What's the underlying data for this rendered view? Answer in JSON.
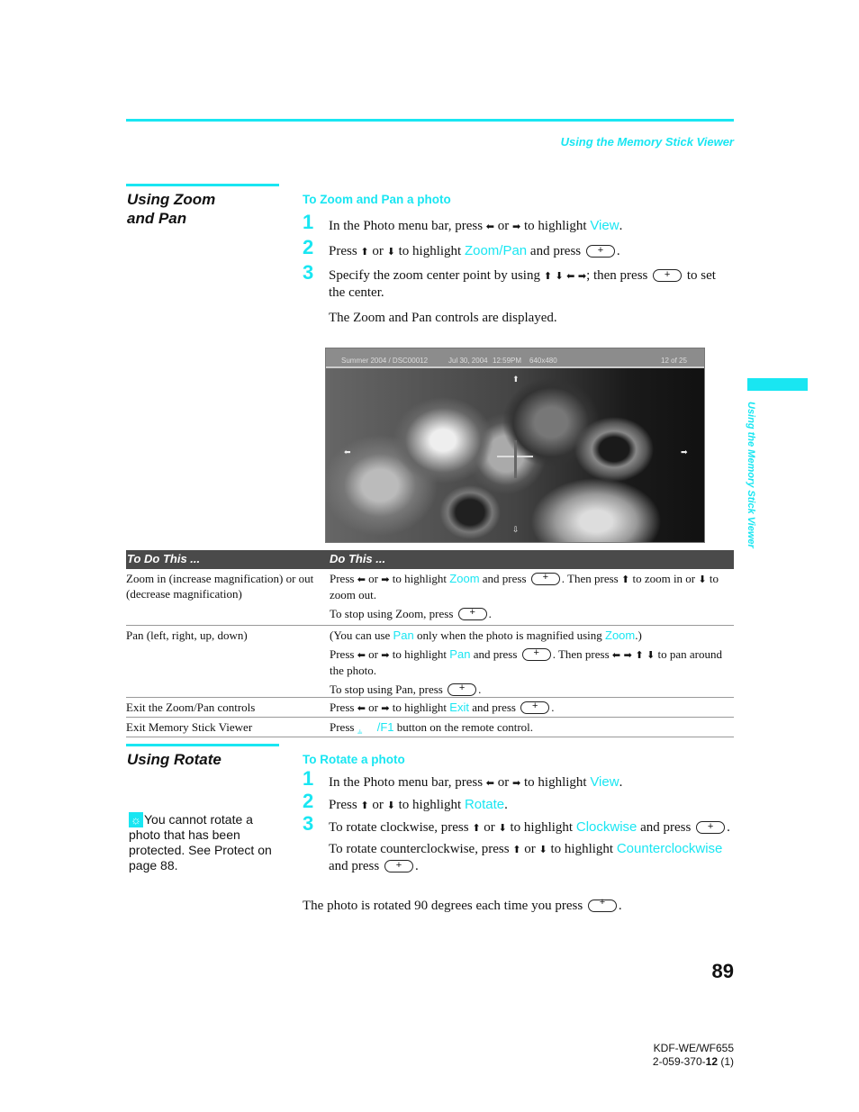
{
  "header": {
    "running_head": "Using the Memory Stick Viewer",
    "side_tab_label": "Using the Memory Stick Viewer"
  },
  "zoom_section": {
    "title_line1": "Using Zoom",
    "title_line2": "and Pan",
    "subhead": "To Zoom and Pan a photo",
    "steps": [
      {
        "num": "1",
        "pre": "In the Photo menu bar, press",
        "arrows1": "⬅",
        "or": "or",
        "arrows2": "➡",
        "mid": "to highlight",
        "hl": "View",
        "post": "."
      },
      {
        "num": "2",
        "pre": "Press",
        "arrows1": "⬆",
        "or": "or",
        "arrows2": "⬇",
        "mid": "to highlight",
        "hl": "Zoom/Pan",
        "post2": "and press",
        "end": "."
      },
      {
        "num": "3",
        "pre": "Specify the zoom center point by using",
        "arrows": "⬆ ⬇ ⬅ ➡",
        "mid": "; then press",
        "post": "to set the center."
      }
    ],
    "note": "The Zoom and Pan controls are displayed."
  },
  "screen": {
    "album": "Summer 2004  /  DSC00012",
    "date": "Jul 30, 2004",
    "time": "12:59PM",
    "resolution": "640x480",
    "counter": "12 of 25",
    "arrow_up": "⬆",
    "arrow_down": "⇩",
    "arrow_left": "⬅",
    "arrow_right": "➡"
  },
  "table": {
    "headers": [
      "To Do This ...",
      "Do This ..."
    ],
    "rows": [
      {
        "action": "Zoom in (increase magnification) or out (decrease magnification)",
        "p1_pre": "Press",
        "p1_a1": "⬅",
        "p1_or": "or",
        "p1_a2": "➡",
        "p1_mid": "to highlight",
        "p1_hl": "Zoom",
        "p1_post": "and press",
        "p1_then": ". Then press",
        "p1_up": "⬆",
        "p1_zin": "to zoom in or",
        "p1_down": "⬇",
        "p1_zout": "to zoom out.",
        "p2": "To stop using Zoom, press",
        "p2_end": "."
      },
      {
        "action": "Pan (left, right, up, down)",
        "p0_pre": "(You can use",
        "p0_hl1": "Pan",
        "p0_mid": "only when the photo is magnified using",
        "p0_hl2": "Zoom",
        "p0_end": ".)",
        "p1_pre": "Press",
        "p1_a1": "⬅",
        "p1_or": "or",
        "p1_a2": "➡",
        "p1_mid": "to highlight",
        "p1_hl": "Pan",
        "p1_post": "and press",
        "p1_then": ". Then press",
        "p1_arrows": "⬅ ➡ ⬆ ⬇",
        "p1_end": "to pan around the photo.",
        "p2": "To stop using Pan, press",
        "p2_end": "."
      },
      {
        "action": "Exit the Zoom/Pan controls",
        "p1_pre": "Press",
        "p1_a1": "⬅",
        "p1_or": "or",
        "p1_a2": "➡",
        "p1_mid": "to highlight",
        "p1_hl": "Exit",
        "p1_post": "and press",
        "p1_end": "."
      },
      {
        "action": "Exit Memory Stick Viewer",
        "p1_pre": "Press",
        "p1_icon": "⫨",
        "p1_hl": "/F1",
        "p1_post": "button on the remote control."
      }
    ]
  },
  "rotate_section": {
    "title": "Using Rotate",
    "subhead": "To Rotate a photo",
    "tip_icon": "☼",
    "tip": "You cannot rotate a photo that has been protected. See Protect on page 88.",
    "steps": [
      {
        "num": "1",
        "pre": "In the Photo menu bar, press",
        "arrows1": "⬅",
        "or": "or",
        "arrows2": "➡",
        "mid": "to highlight",
        "hl": "View",
        "post": "."
      },
      {
        "num": "2",
        "pre": "Press",
        "arrows1": "⬆",
        "or": "or",
        "arrows2": "⬇",
        "mid": "to highlight",
        "hl": "Rotate",
        "post": "."
      },
      {
        "num": "3",
        "pre": "To rotate clockwise, press",
        "arrows1": "⬆",
        "or": "or",
        "arrows2": "⬇",
        "mid": "to highlight",
        "hl": "Clockwise",
        "post": "and press",
        "end": ".",
        "ccw_pre": "To rotate counterclockwise, press",
        "ccw_hl": "Counterclockwise",
        "ccw_post": "and press",
        "ccw_end": "."
      }
    ],
    "note": "The photo is rotated 90 degrees each time you press",
    "note_end": "."
  },
  "footer": {
    "page_number": "89",
    "model": "KDF-WE/WF655",
    "code_prefix": "2-059-370-",
    "code_bold": "12",
    "code_suffix": " (1)"
  }
}
